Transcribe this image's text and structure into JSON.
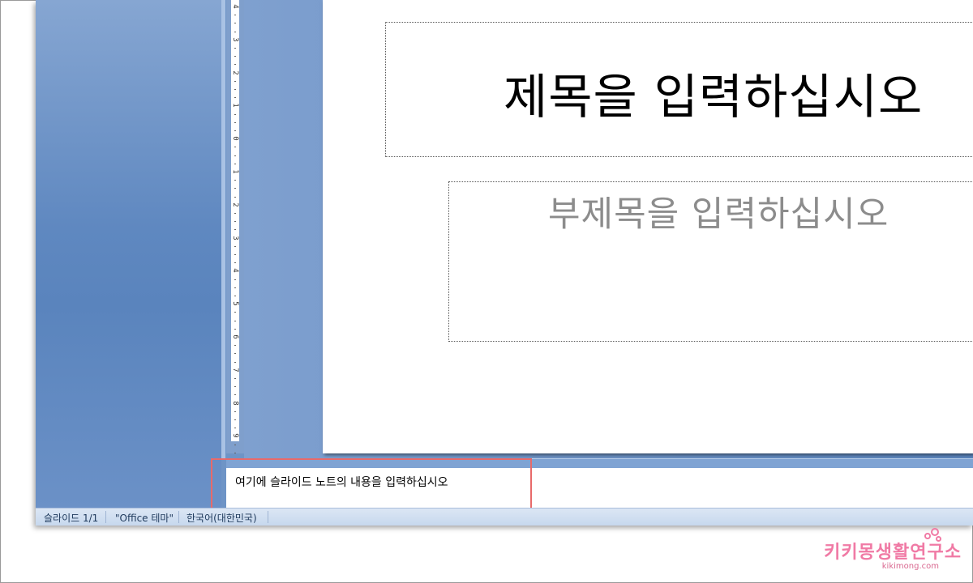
{
  "slide": {
    "title_placeholder": "제목을 입력하십시오",
    "subtitle_placeholder": "부제목을 입력하십시오"
  },
  "notes": {
    "placeholder": "여기에 슬라이드 노트의 내용을 입력하십시오"
  },
  "ruler": {
    "labels": [
      "4",
      "3",
      "2",
      "1",
      "0",
      "1",
      "2",
      "3",
      "4",
      "5",
      "6",
      "7",
      "8",
      "9"
    ]
  },
  "status_bar": {
    "slide_counter": "슬라이드 1/1",
    "theme": "\"Office 테마\"",
    "language": "한국어(대한민국)"
  },
  "watermark": {
    "brand": "키키몽생활연구소",
    "site": "kikimong.com"
  },
  "colors": {
    "highlight_border": "#e86a6a",
    "workspace_blue": "#6e94c6",
    "watermark_pink": "#f07aa5"
  }
}
